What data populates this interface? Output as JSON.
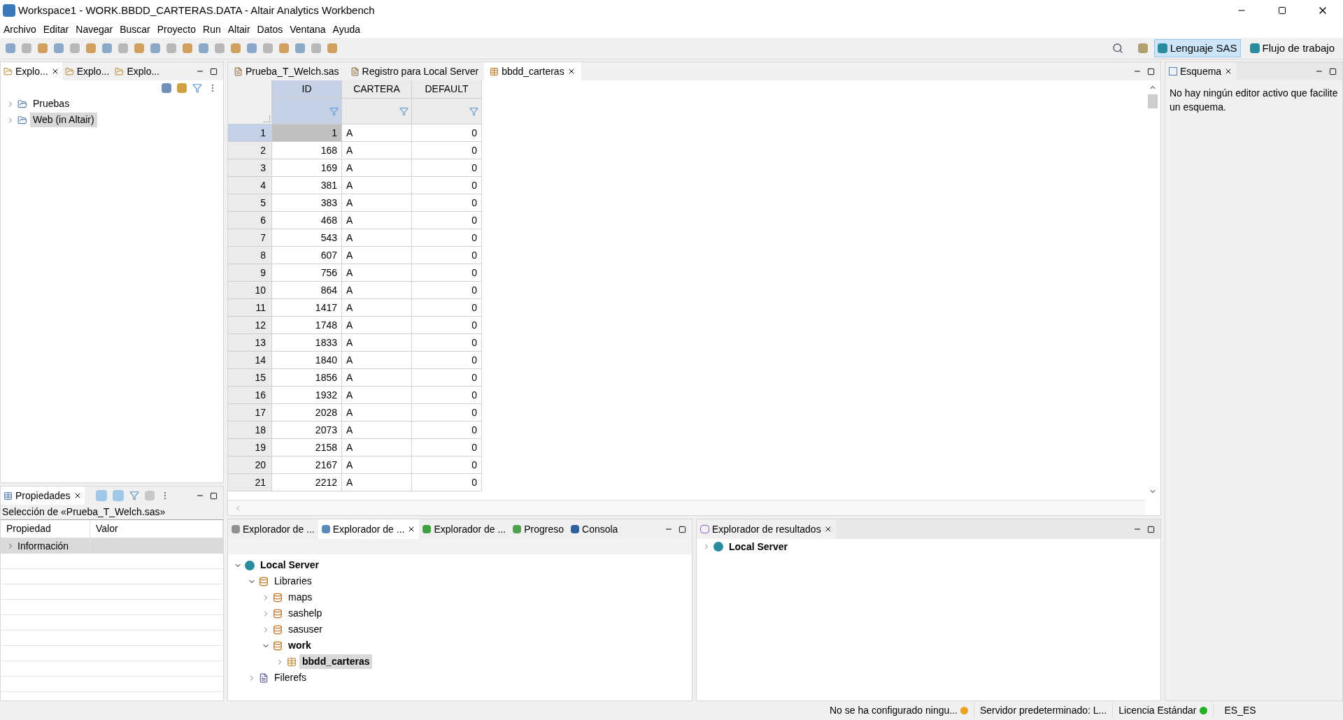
{
  "window": {
    "title": "Workspace1 - WORK.BBDD_CARTERAS.DATA - Altair Analytics Workbench"
  },
  "menu": [
    "Archivo",
    "Editar",
    "Navegar",
    "Buscar",
    "Proyecto",
    "Run",
    "Altair",
    "Datos",
    "Ventana",
    "Ayuda"
  ],
  "perspectives": [
    {
      "label": "Lenguaje SAS",
      "selected": true
    },
    {
      "label": "Flujo de trabajo",
      "selected": false
    }
  ],
  "left_tabs": [
    {
      "label": "Explo...",
      "selected": true
    },
    {
      "label": "Explo...",
      "selected": false
    },
    {
      "label": "Explo...",
      "selected": false
    }
  ],
  "project_tree": [
    {
      "label": "Pruebas",
      "selected": false
    },
    {
      "label": "Web (in Altair)",
      "selected": true
    }
  ],
  "properties": {
    "tab": "Propiedades",
    "selection": "Selección de «Prueba_T_Welch.sas»",
    "columns": [
      "Propiedad",
      "Valor"
    ],
    "rows": [
      {
        "label": "Información",
        "selected": true
      }
    ]
  },
  "editor_tabs": [
    {
      "label": "Prueba_T_Welch.sas",
      "selected": false
    },
    {
      "label": "Registro para Local Server",
      "selected": false
    },
    {
      "label": "bbdd_carteras",
      "selected": true
    }
  ],
  "table": {
    "columns": [
      {
        "label": "ID",
        "selected": true
      },
      {
        "label": "CARTERA",
        "selected": false
      },
      {
        "label": "DEFAULT",
        "selected": false
      }
    ],
    "rows": [
      {
        "n": "1",
        "cells": [
          "1",
          "A",
          "0"
        ],
        "selected": true
      },
      {
        "n": "2",
        "cells": [
          "168",
          "A",
          "0"
        ],
        "selected": false
      },
      {
        "n": "3",
        "cells": [
          "169",
          "A",
          "0"
        ],
        "selected": false
      },
      {
        "n": "4",
        "cells": [
          "381",
          "A",
          "0"
        ],
        "selected": false
      },
      {
        "n": "5",
        "cells": [
          "383",
          "A",
          "0"
        ],
        "selected": false
      },
      {
        "n": "6",
        "cells": [
          "468",
          "A",
          "0"
        ],
        "selected": false
      },
      {
        "n": "7",
        "cells": [
          "543",
          "A",
          "0"
        ],
        "selected": false
      },
      {
        "n": "8",
        "cells": [
          "607",
          "A",
          "0"
        ],
        "selected": false
      },
      {
        "n": "9",
        "cells": [
          "756",
          "A",
          "0"
        ],
        "selected": false
      },
      {
        "n": "10",
        "cells": [
          "864",
          "A",
          "0"
        ],
        "selected": false
      },
      {
        "n": "11",
        "cells": [
          "1417",
          "A",
          "0"
        ],
        "selected": false
      },
      {
        "n": "12",
        "cells": [
          "1748",
          "A",
          "0"
        ],
        "selected": false
      },
      {
        "n": "13",
        "cells": [
          "1833",
          "A",
          "0"
        ],
        "selected": false
      },
      {
        "n": "14",
        "cells": [
          "1840",
          "A",
          "0"
        ],
        "selected": false
      },
      {
        "n": "15",
        "cells": [
          "1856",
          "A",
          "0"
        ],
        "selected": false
      },
      {
        "n": "16",
        "cells": [
          "1932",
          "A",
          "0"
        ],
        "selected": false
      },
      {
        "n": "17",
        "cells": [
          "2028",
          "A",
          "0"
        ],
        "selected": false
      },
      {
        "n": "18",
        "cells": [
          "2073",
          "A",
          "0"
        ],
        "selected": false
      },
      {
        "n": "19",
        "cells": [
          "2158",
          "A",
          "0"
        ],
        "selected": false
      },
      {
        "n": "20",
        "cells": [
          "2167",
          "A",
          "0"
        ],
        "selected": false
      },
      {
        "n": "21",
        "cells": [
          "2212",
          "A",
          "0"
        ],
        "selected": false
      }
    ]
  },
  "bottom_tabs": [
    {
      "label": "Explorador de ...",
      "selected": false
    },
    {
      "label": "Explorador de ...",
      "selected": true
    },
    {
      "label": "Explorador de ...",
      "selected": false
    },
    {
      "label": "Progreso",
      "selected": false
    },
    {
      "label": "Consola",
      "selected": false
    }
  ],
  "server_tree": [
    {
      "label": "Local Server",
      "kind": "server",
      "bold": true,
      "expanded": true,
      "selected": false,
      "children": [
        {
          "label": "Libraries",
          "kind": "libraries",
          "bold": false,
          "expanded": true,
          "selected": false,
          "children": [
            {
              "label": "maps",
              "kind": "library",
              "bold": false,
              "expanded": false,
              "selected": false
            },
            {
              "label": "sashelp",
              "kind": "library",
              "bold": false,
              "expanded": false,
              "selected": false
            },
            {
              "label": "sasuser",
              "kind": "library",
              "bold": false,
              "expanded": false,
              "selected": false
            },
            {
              "label": "work",
              "kind": "library",
              "bold": true,
              "expanded": true,
              "selected": false,
              "children": [
                {
                  "label": "bbdd_carteras",
                  "kind": "dataset",
                  "bold": true,
                  "expanded": false,
                  "selected": true
                }
              ]
            }
          ]
        },
        {
          "label": "Filerefs",
          "kind": "filerefs",
          "bold": false,
          "expanded": false,
          "selected": false
        }
      ]
    }
  ],
  "results": {
    "tab": "Explorador de resultados",
    "tree": [
      {
        "label": "Local Server",
        "bold": true
      }
    ]
  },
  "outline": {
    "tab": "Esquema",
    "message": "No hay ningún editor activo que facilite un esquema."
  },
  "status_bar": [
    {
      "text": "No se ha configurado ningu...",
      "color": "#f0a020"
    },
    {
      "text": "Servidor predeterminado: L..."
    },
    {
      "text": "Licencia Estándar",
      "color": "#20b020"
    },
    {
      "text": "ES_ES"
    }
  ]
}
